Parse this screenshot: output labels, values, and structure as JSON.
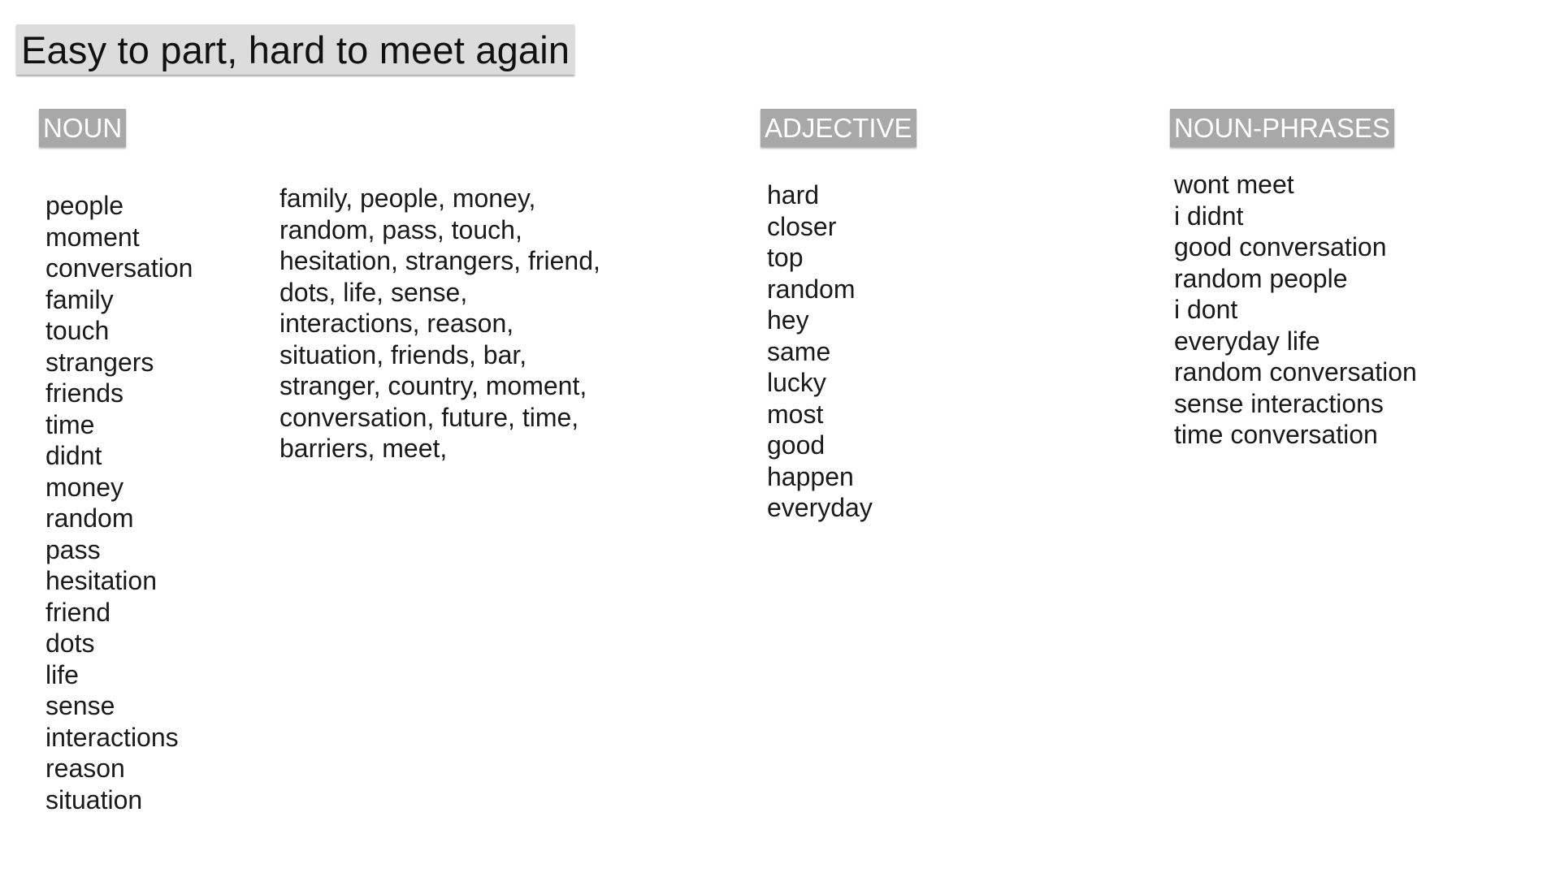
{
  "title": "Easy to part, hard to meet again",
  "noun": {
    "label": "NOUN",
    "words": [
      "people",
      "moment",
      "conversation",
      "family",
      "touch",
      "strangers",
      "friends",
      "time",
      "didnt",
      "money",
      "random",
      "pass",
      "hesitation",
      "friend",
      "dots",
      "life",
      "sense",
      "interactions",
      "reason",
      "situation"
    ],
    "summary_lines": [
      "family, people, money,",
      "random, pass, touch,",
      "hesitation, strangers, friend,",
      "dots, life, sense,",
      "interactions, reason,",
      "situation, friends, bar,",
      "stranger, country, moment,",
      "conversation, future, time,",
      "barriers, meet,"
    ]
  },
  "adjective": {
    "label": "ADJECTIVE",
    "words": [
      "hard",
      "closer",
      "top",
      "random",
      "hey",
      "same",
      "lucky",
      "most",
      "good",
      "happen",
      "everyday"
    ]
  },
  "noun_phrases": {
    "label": "NOUN-PHRASES",
    "words": [
      "wont meet",
      "i didnt",
      "good conversation",
      "random people",
      "i dont",
      "everyday life",
      "random conversation",
      "sense interactions",
      "time conversation"
    ]
  }
}
